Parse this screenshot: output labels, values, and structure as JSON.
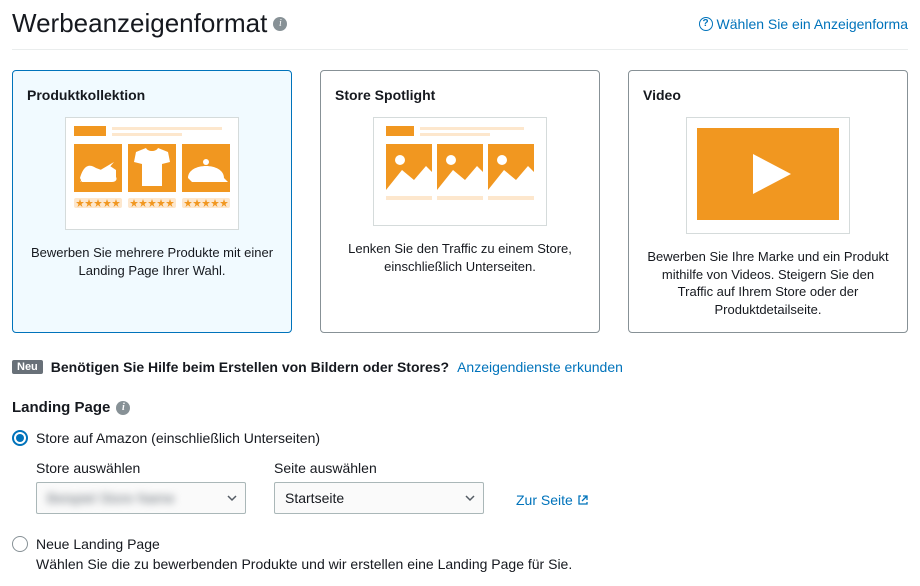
{
  "header": {
    "title": "Werbeanzeigenformat",
    "help_link": "Wählen Sie ein Anzeigenforma"
  },
  "cards": {
    "product": {
      "title": "Produktkollektion",
      "desc": "Bewerben Sie mehrere Produkte mit einer Landing Page Ihrer Wahl."
    },
    "spotlight": {
      "title": "Store Spotlight",
      "desc": "Lenken Sie den Traffic zu einem Store, einschließlich Unterseiten."
    },
    "video": {
      "title": "Video",
      "desc": "Bewerben Sie Ihre Marke und ein Produkt mithilfe von Videos. Steigern Sie den Traffic auf Ihrem Store oder der Produktdetailseite."
    }
  },
  "help": {
    "badge": "Neu",
    "text": "Benötigen Sie Hilfe beim Erstellen von Bildern oder Stores?",
    "link": "Anzeigendienste erkunden"
  },
  "landing": {
    "label": "Landing Page",
    "option_store": "Store auf Amazon (einschließlich Unterseiten)",
    "store_select_label": "Store auswählen",
    "store_value": "Beispiel Store Name",
    "page_select_label": "Seite auswählen",
    "page_value": "Startseite",
    "to_page": "Zur Seite",
    "option_new": "Neue Landing Page",
    "option_new_desc": "Wählen Sie die zu bewerbenden Produkte und wir erstellen eine Landing Page für Sie."
  }
}
